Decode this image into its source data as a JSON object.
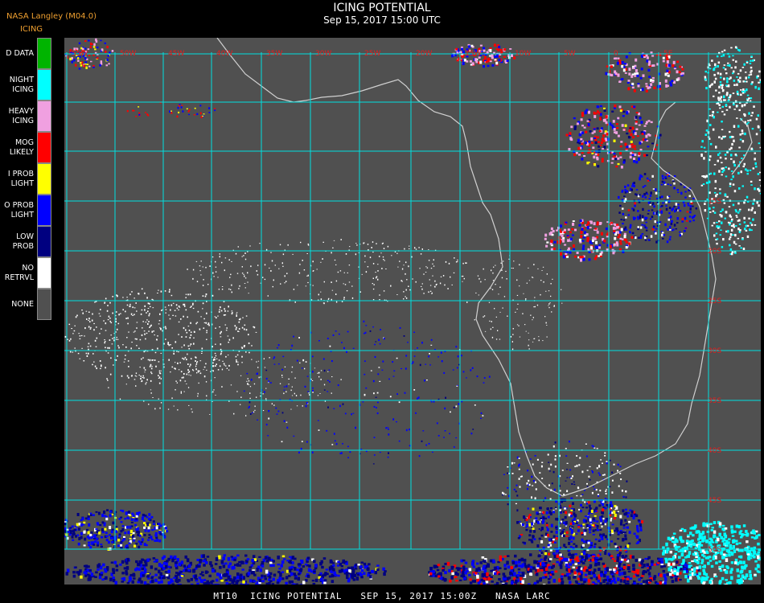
{
  "header": {
    "source": "NASA Langley (M04.0)",
    "legend_title": "ICING",
    "title": "ICING POTENTIAL",
    "subtitle": "Sep 15, 2017 15:00 UTC"
  },
  "legend": [
    {
      "label": "D DATA",
      "color": "#00b400"
    },
    {
      "label": "NIGHT\nICING",
      "color": "#00ffff"
    },
    {
      "label": "HEAVY\nICING",
      "color": "#f0a0e0"
    },
    {
      "label": "MOG\nLIKELY",
      "color": "#ff0000"
    },
    {
      "label": "I PROB\nLIGHT",
      "color": "#ffff00"
    },
    {
      "label": "O PROB\nLIGHT",
      "color": "#0000ff"
    },
    {
      "label": "LOW\nPROB",
      "color": "#000080"
    },
    {
      "label": "NO\nRETRVL",
      "color": "#ffffff"
    },
    {
      "label": "NONE",
      "color": "#505050"
    }
  ],
  "map": {
    "background": "#505050",
    "grid_color": "#00e0e0",
    "coast_color": "#d0d0d0",
    "top_labels": [
      "55W",
      "50W",
      "45W",
      "40W",
      "35W",
      "30W",
      "25W",
      "20W",
      "15W",
      "10W",
      "5W",
      "0",
      "5E"
    ],
    "right_labels": [
      "15S",
      "20S",
      "25S",
      "30S",
      "35S",
      "40S",
      "45S",
      "50S"
    ]
  },
  "footer": "MT10  ICING POTENTIAL   SEP 15, 2017 15:00Z   NASA LARC"
}
